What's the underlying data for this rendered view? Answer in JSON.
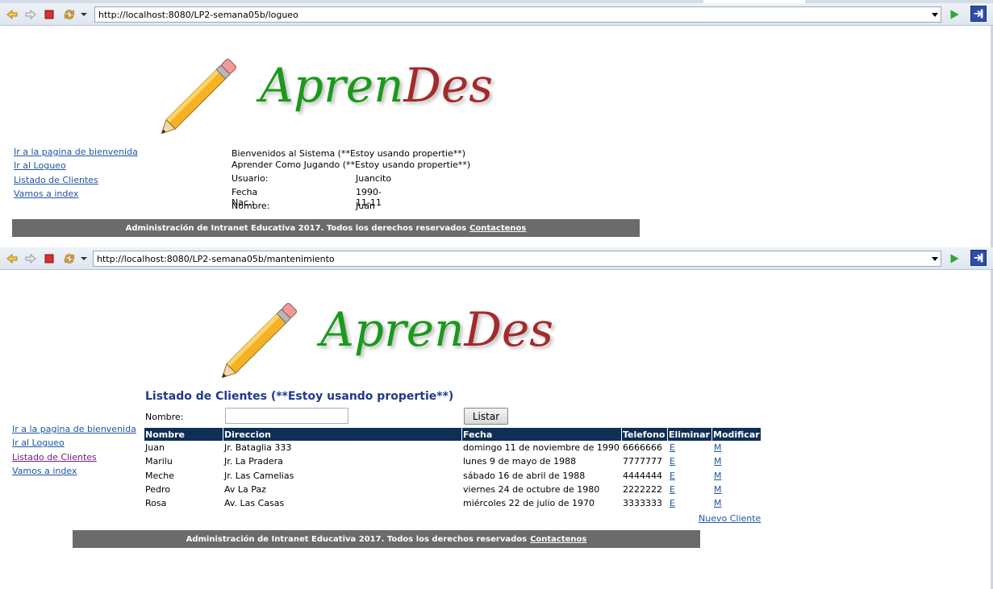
{
  "browser": {
    "window1_url": "http://localhost:8080/LP2-semana05b/logueo",
    "window2_url": "http://localhost:8080/LP2-semana05b/mantenimiento",
    "icons": [
      "back-icon",
      "forward-icon",
      "stop-icon",
      "refresh-icon",
      "chevron-down-icon",
      "go-icon",
      "external-browser-icon"
    ]
  },
  "logo": {
    "part1": "Apren",
    "part2": "Des",
    "color1": "#1a9a1a",
    "color2": "#a52a2a",
    "image": "pencil-icon"
  },
  "nav": {
    "items": [
      "Ir a la pagina de bienvenida",
      "Ir al Logueo",
      "Listado de Clientes",
      "Vamos a index"
    ]
  },
  "login_page": {
    "welcome_line1": "Bienvenidos al Sistema (**Estoy usando propertie**)",
    "welcome_line2": "Aprender Como Jugando (**Estoy usando propertie**)",
    "fields": [
      {
        "label": "Usuario:",
        "value": "Juancito"
      },
      {
        "label": "Fecha Nac.:",
        "value": "1990-11-11"
      },
      {
        "label": "Nombre:",
        "value": "Juan"
      }
    ]
  },
  "footer": {
    "text": "Administración de Intranet Educativa 2017. Todos los derechos reservados",
    "link": "Contactenos",
    "bg_color": "#6b6b6b"
  },
  "clients_page": {
    "title": "Listado de Clientes (**Estoy usando propertie**)",
    "filter_label": "Nombre:",
    "filter_value": "",
    "list_button": "Listar",
    "columns": [
      "Nombre",
      "Direccion",
      "Fecha",
      "Telefono",
      "Eliminar",
      "Modificar"
    ],
    "rows": [
      {
        "nombre": "Juan",
        "direccion": "Jr. Bataglia 333",
        "fecha": "domingo 11 de noviembre de 1990",
        "telefono": "6666666",
        "eliminar": "E",
        "modificar": "M"
      },
      {
        "nombre": "Marilu",
        "direccion": "Jr. La Pradera",
        "fecha": "lunes 9 de mayo de 1988",
        "telefono": "7777777",
        "eliminar": "E",
        "modificar": "M"
      },
      {
        "nombre": "Meche",
        "direccion": "Jr. Las Camelias",
        "fecha": "sábado 16 de abril de 1988",
        "telefono": "4444444",
        "eliminar": "E",
        "modificar": "M"
      },
      {
        "nombre": "Pedro",
        "direccion": "Av La Paz",
        "fecha": "viernes 24 de octubre de 1980",
        "telefono": "2222222",
        "eliminar": "E",
        "modificar": "M"
      },
      {
        "nombre": "Rosa",
        "direccion": "Av. Las Casas",
        "fecha": "miércoles 22 de julio de 1970",
        "telefono": "3333333",
        "eliminar": "E",
        "modificar": "M"
      }
    ],
    "new_client_link": "Nuevo Cliente",
    "header_color": "#0f2f55"
  }
}
